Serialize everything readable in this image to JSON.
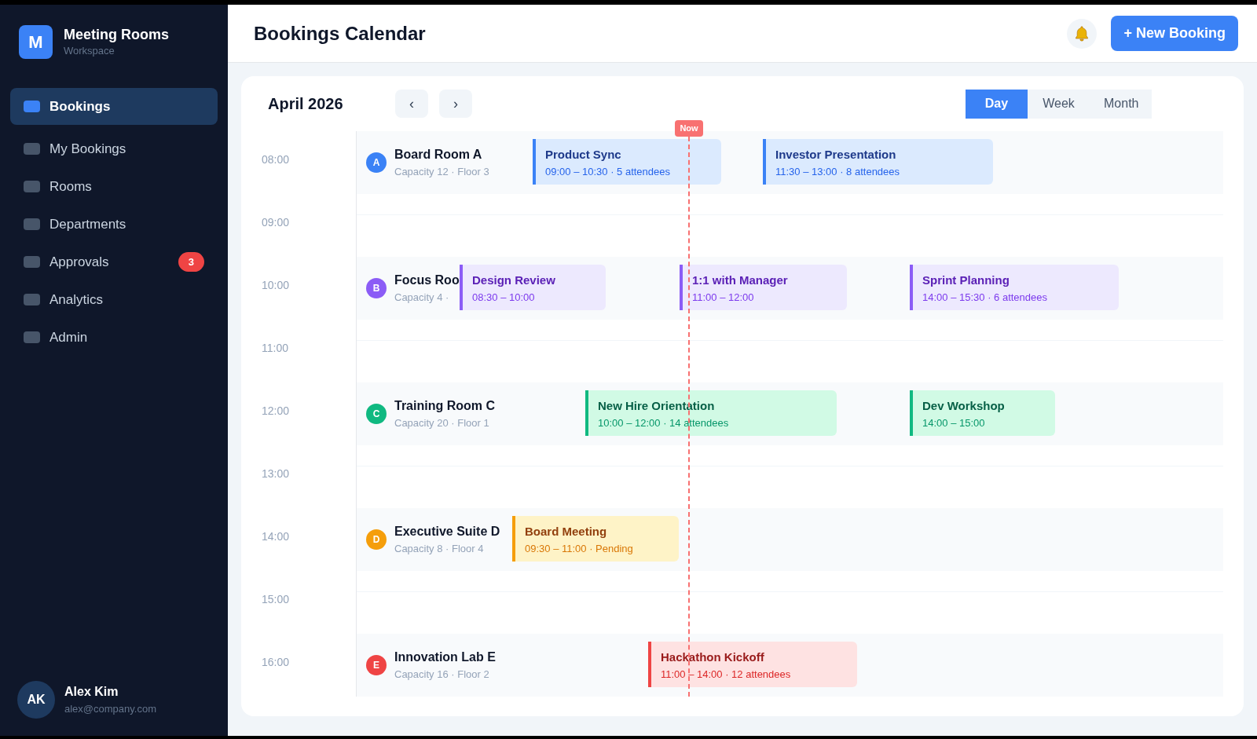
{
  "sidebar": {
    "brand": {
      "logo": "M",
      "name": "Meeting Rooms",
      "subtitle": "Workspace"
    },
    "items": [
      {
        "label": "Bookings",
        "selected": true
      },
      {
        "label": "My Bookings",
        "selected": false
      },
      {
        "label": "Rooms",
        "selected": false
      },
      {
        "label": "Departments",
        "selected": false
      },
      {
        "label": "Approvals",
        "selected": false,
        "badge": "3"
      },
      {
        "label": "Analytics",
        "selected": false
      },
      {
        "label": "Admin",
        "selected": false
      }
    ],
    "user": {
      "initials": "AK",
      "name": "Alex Kim",
      "email": "alex@company.com"
    }
  },
  "header": {
    "title": "Bookings Calendar",
    "new_button": "+ New Booking"
  },
  "calendar": {
    "month": "April 2026",
    "prev": "‹",
    "next": "›",
    "views": [
      {
        "label": "Day",
        "selected": true
      },
      {
        "label": "Week",
        "selected": false
      },
      {
        "label": "Month",
        "selected": false
      }
    ],
    "now_label": "Now",
    "rows": [
      {
        "time": "08:00",
        "room": {
          "letter": "A",
          "name": "Board Room A",
          "details": "Capacity 12 · Floor 3",
          "color": "#3b82f6",
          "events": [
            {
              "title": "Product Sync",
              "details": "09:00 – 10:30 · 5 attendees"
            },
            {
              "title": "Investor Presentation",
              "details": "11:30 – 13:00 · 8 attendees"
            }
          ]
        }
      },
      {
        "time": "09:00"
      },
      {
        "time": "10:00",
        "room": {
          "letter": "B",
          "name": "Focus Roo",
          "details": "Capacity 4 ·",
          "color": "#8b5cf6",
          "events": [
            {
              "title": "Design Review",
              "details": "08:30 – 10:00"
            },
            {
              "title": "1:1 with Manager",
              "details": "11:00 – 12:00"
            },
            {
              "title": "Sprint Planning",
              "details": "14:00 – 15:30 · 6 attendees"
            }
          ]
        }
      },
      {
        "time": "11:00"
      },
      {
        "time": "12:00",
        "room": {
          "letter": "C",
          "name": "Training Room C",
          "details": "Capacity 20 · Floor 1",
          "color": "#10b981",
          "events": [
            {
              "title": "New Hire Orientation",
              "details": "10:00 – 12:00 · 14 attendees"
            },
            {
              "title": "Dev Workshop",
              "details": "14:00 – 15:00"
            }
          ]
        }
      },
      {
        "time": "13:00"
      },
      {
        "time": "14:00",
        "room": {
          "letter": "D",
          "name": "Executive Suite D",
          "details": "Capacity 8 · Floor 4",
          "color": "#f59e0b",
          "events": [
            {
              "title": "Board Meeting",
              "details": "09:30 – 11:00 · Pending"
            }
          ]
        }
      },
      {
        "time": "15:00"
      },
      {
        "time": "16:00",
        "room": {
          "letter": "E",
          "name": "Innovation Lab E",
          "details": "Capacity 16 · Floor 2",
          "color": "#ef4444",
          "events": [
            {
              "title": "Hackathon Kickoff",
              "details": "11:00 – 14:00 · 12 attendees"
            }
          ]
        }
      }
    ]
  }
}
